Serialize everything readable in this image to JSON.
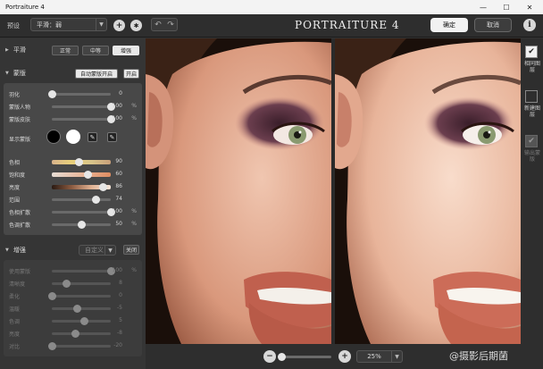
{
  "window": {
    "title": "Portraiture 4",
    "minimize": "—",
    "maximize": "☐",
    "close": "✕"
  },
  "toolbar": {
    "preset_label": "预设",
    "preset_value": "平滑：弱",
    "brand": "PORTRAITURE 4",
    "ok_label": "确定",
    "cancel_label": "取消",
    "info_glyph": "i",
    "plus_glyph": "+",
    "gear_glyph": "✱",
    "undo_glyph": "↶",
    "redo_glyph": "↷"
  },
  "smoothing": {
    "title": "平滑",
    "options": [
      "正常",
      "中等",
      "增强"
    ],
    "selected": 2
  },
  "mask": {
    "title": "蒙版",
    "auto_label": "自动蒙版开启",
    "toggle_label": "开启",
    "feather": {
      "label": "羽化",
      "value": "0",
      "pct": ""
    },
    "mask_person": {
      "label": "蒙版人物",
      "value": "100",
      "pct": "%"
    },
    "mask_skin": {
      "label": "蒙版皮肤",
      "value": "100",
      "pct": "%"
    },
    "show_mask_label": "显示蒙版",
    "hue": {
      "label": "色相",
      "value": "90",
      "pct": ""
    },
    "saturation": {
      "label": "饱和度",
      "value": "60",
      "pct": ""
    },
    "luminance": {
      "label": "亮度",
      "value": "86",
      "pct": ""
    },
    "range": {
      "label": "范围",
      "value": "74",
      "pct": ""
    },
    "hue_expand": {
      "label": "色相扩散",
      "value": "100",
      "pct": "%"
    },
    "tone_expand": {
      "label": "色调扩散",
      "value": "50",
      "pct": "%"
    }
  },
  "enhance": {
    "title": "增强",
    "preset": "自定义",
    "toggle_label": "关闭",
    "rows": [
      {
        "label": "使用蒙版",
        "value": "100",
        "pct": "%",
        "pos": 1.0
      },
      {
        "label": "清晰度",
        "value": "8",
        "pct": "",
        "pos": 0.24
      },
      {
        "label": "柔化",
        "value": "0",
        "pct": "",
        "pos": 0.0
      },
      {
        "label": "温暖",
        "value": "-5",
        "pct": "",
        "pos": 0.43
      },
      {
        "label": "色调",
        "value": "5",
        "pct": "",
        "pos": 0.55
      },
      {
        "label": "亮度",
        "value": "-8",
        "pct": "",
        "pos": 0.4
      },
      {
        "label": "对比",
        "value": "-20",
        "pct": "",
        "pos": 0.0
      }
    ]
  },
  "slider_positions": {
    "feather": 0.0,
    "mask_person": 1.0,
    "mask_skin": 1.0,
    "hue": 0.45,
    "saturation": 0.6,
    "luminance": 0.86,
    "range": 0.74,
    "hue_expand": 1.0,
    "tone_expand": 0.5
  },
  "zoom": {
    "minus": "−",
    "plus": "+",
    "value": "25%",
    "slider_pos": 0.0
  },
  "rightpanel": {
    "items": [
      {
        "label": "相同图层",
        "checked": true
      },
      {
        "label": "新建图层",
        "checked": false
      },
      {
        "label": "输出蒙版",
        "checked": true
      }
    ]
  },
  "watermark": "@摄影后期菌",
  "colors": {
    "accent": "#e8e8e8",
    "mask_black": "#000000",
    "mask_white": "#ffffff"
  }
}
